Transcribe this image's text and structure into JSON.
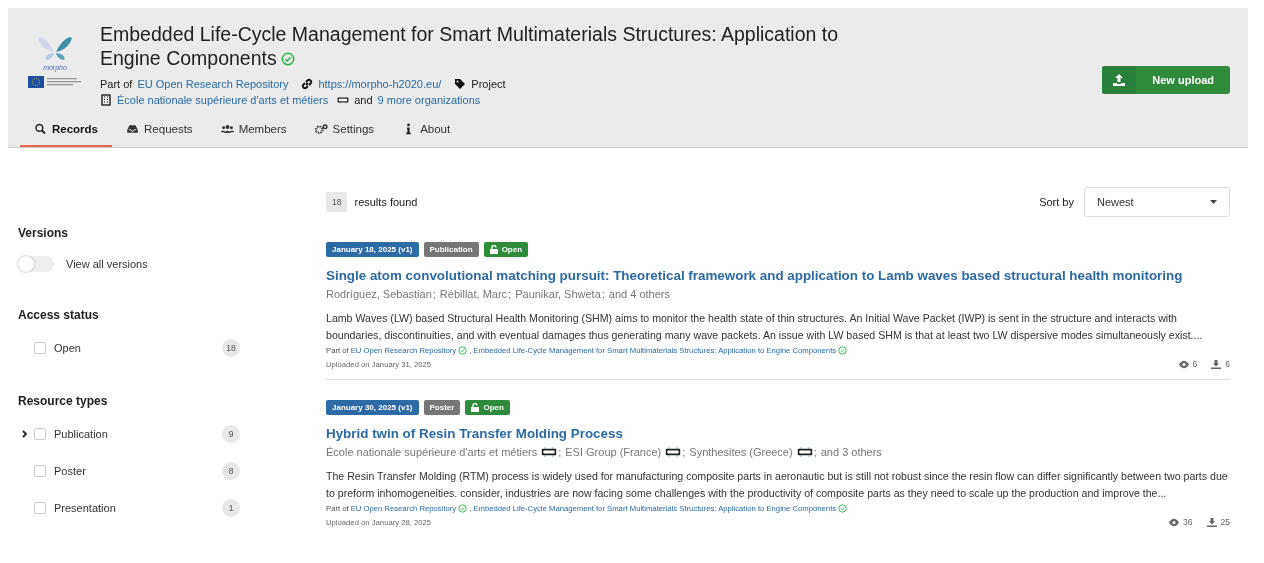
{
  "header": {
    "logo_text": "morpho",
    "title": "Embedded Life-Cycle Management for Smart Multimaterials Structures: Application to Engine Components",
    "verified": true,
    "part_of_label": "Part of",
    "part_of_link": "EU Open Research Repository",
    "website": "https://morpho-h2020.eu/",
    "type": "Project",
    "organization": "École nationale supérieure d'arts et métiers",
    "org_and": "and",
    "more_orgs": "9 more organizations",
    "new_upload": "New upload"
  },
  "tabs": [
    {
      "label": "Records",
      "selected": true
    },
    {
      "label": "Requests",
      "selected": false
    },
    {
      "label": "Members",
      "selected": false
    },
    {
      "label": "Settings",
      "selected": false
    },
    {
      "label": "About",
      "selected": false
    }
  ],
  "sidebar": {
    "sections": [
      {
        "title": "Versions",
        "kind": "toggle",
        "toggle": {
          "label": "View all versions",
          "on": false
        }
      },
      {
        "title": "Access status",
        "kind": "checkboxes",
        "items": [
          {
            "label": "Open",
            "count": "18",
            "checked": false
          }
        ]
      },
      {
        "title": "Resource types",
        "kind": "checkboxes",
        "items": [
          {
            "label": "Publication",
            "count": "9",
            "checked": false,
            "expanded": false
          },
          {
            "label": "Poster",
            "count": "8",
            "checked": false
          },
          {
            "label": "Presentation",
            "count": "1",
            "checked": false
          }
        ]
      }
    ]
  },
  "results": {
    "count": "18",
    "label": "results found",
    "sort_label": "Sort by",
    "sort_value": "Newest"
  },
  "records": [
    {
      "badges": [
        {
          "kind": "date",
          "label": "January 18, 2025 (v1)"
        },
        {
          "kind": "type",
          "label": "Publication"
        },
        {
          "kind": "access",
          "label": "Open"
        }
      ],
      "title": "Single atom convolutional matching pursuit: Theoretical framework and application to Lamb waves based structural health monitoring",
      "creators": [
        {
          "name": "Rodríguez, Sebastian",
          "ror": false,
          "separator": ";"
        },
        {
          "name": "Rébillat, Marc",
          "ror": false,
          "separator": ";"
        },
        {
          "name": "Paunikar, Shweta",
          "ror": false,
          "separator": ";"
        }
      ],
      "others": "and 4 others",
      "description": "Lamb Waves (LW) based Structural Health Monitoring (SHM) aims to monitor the health state of thin structures. An Initial Wave Packet (IWP) is sent in the structure and interacts with boundaries, discontinuities, and with eventual damages thus generating many wave packets. An issue with LW based SHM is that at least two LW dispersive modes simultaneously exist....",
      "part_of_label": "Part of",
      "part_of": [
        {
          "label": "EU Open Research Repository",
          "verified": true,
          "separator": ","
        },
        {
          "label": "Embedded Life-Cycle Management for Smart Multimaterials Structures: Application to Engine Components",
          "verified": true
        }
      ],
      "uploaded": "Uploaded on January 31, 2025",
      "views": "6",
      "downloads": "6"
    },
    {
      "badges": [
        {
          "kind": "date",
          "label": "January 30, 2025 (v1)"
        },
        {
          "kind": "type",
          "label": "Poster"
        },
        {
          "kind": "access",
          "label": "Open"
        }
      ],
      "title": "Hybrid twin of Resin Transfer Molding Process",
      "creators": [
        {
          "name": "École nationale supérieure d'arts et métiers",
          "ror": true,
          "separator": ";"
        },
        {
          "name": "ESI Group (France)",
          "ror": true,
          "separator": ";"
        },
        {
          "name": "Synthesites (Greece)",
          "ror": true,
          "separator": ";"
        }
      ],
      "others": "and 3 others",
      "description": "The Resin Transfer Molding (RTM) process is widely used for manufacturing composite parts in aeronautic but is still not robust since the resin flow can differ significantly between two parts due to preform inhomogeneities. consider, industries are now facing some challenges with the productivity of composite parts as they need to scale up the production and improve the...",
      "part_of_label": "Part of",
      "part_of": [
        {
          "label": "EU Open Research Repository",
          "verified": true,
          "separator": ","
        },
        {
          "label": "Embedded Life-Cycle Management for Smart Multimaterials Structures: Application to Engine Components",
          "verified": true
        }
      ],
      "uploaded": "Uploaded on January 28, 2025",
      "views": "36",
      "downloads": "25"
    }
  ]
}
